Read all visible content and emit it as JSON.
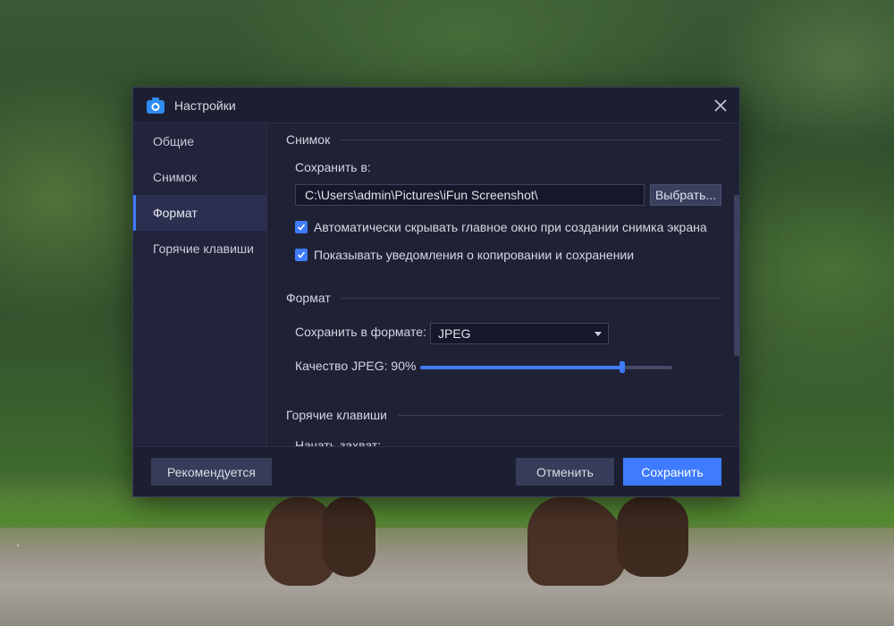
{
  "dialog": {
    "title": "Настройки",
    "close_icon": "close-icon"
  },
  "sidebar": {
    "items": [
      {
        "label": "Общие",
        "active": false
      },
      {
        "label": "Снимок",
        "active": false
      },
      {
        "label": "Формат",
        "active": true
      },
      {
        "label": "Горячие клавиши",
        "active": false
      }
    ]
  },
  "snapshot": {
    "heading": "Снимок",
    "save_to_label": "Сохранить в:",
    "path_value": "C:\\Users\\admin\\Pictures\\iFun Screenshot\\",
    "browse_label": "Выбрать...",
    "auto_hide": {
      "label": "Автоматически скрывать главное окно при создании снимка экрана",
      "checked": true
    },
    "notify": {
      "label": "Показывать уведомления о копировании и сохранении",
      "checked": true
    }
  },
  "format": {
    "heading": "Формат",
    "save_format_label": "Сохранить в формате:",
    "save_format_value": "JPEG",
    "quality_label": "Качество JPEG: 90%",
    "quality_value": 0.8
  },
  "hotkeys": {
    "heading": "Горячие клавиши",
    "start_capture_label": "Начать захват:"
  },
  "footer": {
    "recommended_label": "Рекомендуется",
    "cancel_label": "Отменить",
    "save_label": "Сохранить"
  },
  "colors": {
    "accent": "#3e7bff",
    "dialog_bg": "#1f2235",
    "sidebar_bg": "#21243a",
    "button_bg": "#373c58"
  }
}
